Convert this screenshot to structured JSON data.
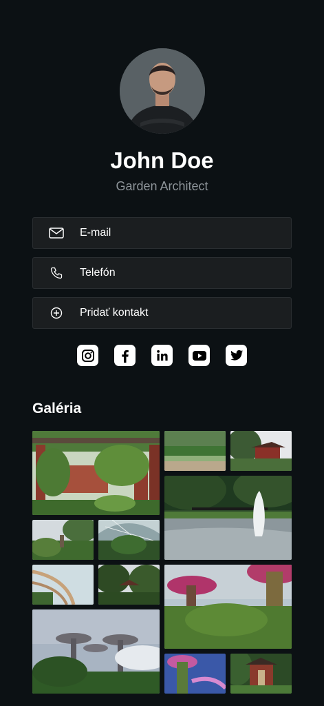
{
  "profile": {
    "name": "John Doe",
    "role": "Garden Architect",
    "avatar_icon": "avatar-person-icon"
  },
  "contacts": [
    {
      "label": "E-mail",
      "icon": "mail-icon"
    },
    {
      "label": "Telefón",
      "icon": "phone-icon"
    },
    {
      "label": "Pridať kontakt",
      "icon": "plus-circle-icon"
    }
  ],
  "socials": [
    {
      "name": "instagram",
      "icon": "instagram-icon"
    },
    {
      "name": "facebook",
      "icon": "facebook-icon"
    },
    {
      "name": "linkedin",
      "icon": "linkedin-icon"
    },
    {
      "name": "youtube",
      "icon": "youtube-icon"
    },
    {
      "name": "twitter",
      "icon": "twitter-icon"
    }
  ],
  "gallery": {
    "title": "Galéria",
    "photo_count": 12
  },
  "colors": {
    "background": "#0c1114",
    "button_bg": "#1b1e20",
    "button_border": "#2a2e31",
    "muted_text": "#8e959a",
    "text": "#ffffff"
  }
}
